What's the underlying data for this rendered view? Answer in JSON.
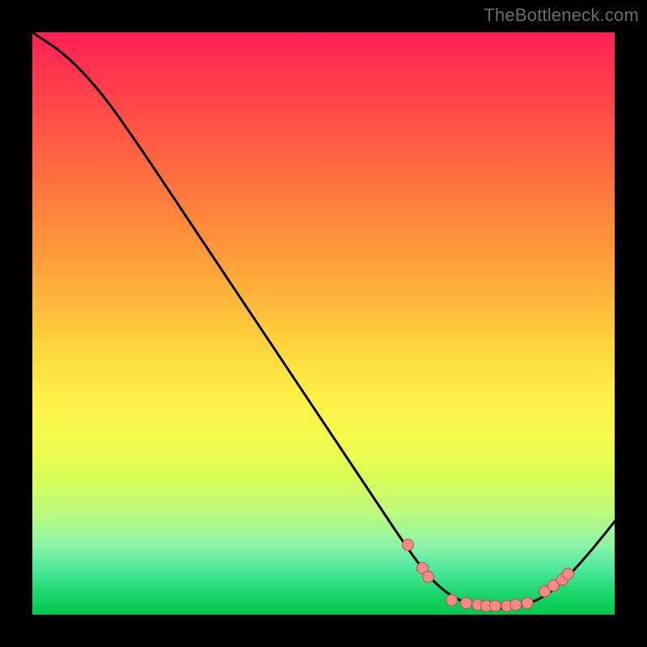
{
  "watermark": "TheBottleneck.com",
  "colors": {
    "line": "#000000",
    "dot_fill": "#f58b87",
    "dot_stroke": "#b84f4b"
  },
  "chart_data": {
    "type": "line",
    "title": "",
    "xlabel": "",
    "ylabel": "",
    "xlim": [
      0,
      100
    ],
    "ylim": [
      0,
      100
    ],
    "series": [
      {
        "name": "curve",
        "x": [
          0,
          6,
          12,
          18,
          24,
          30,
          36,
          42,
          48,
          54,
          60,
          64,
          68,
          72,
          76,
          80,
          84,
          88,
          92,
          96,
          100
        ],
        "y": [
          100,
          96,
          89.5,
          81,
          72,
          63,
          54,
          45,
          36,
          27,
          18,
          12,
          6.5,
          3,
          1.5,
          1,
          1.5,
          3,
          6.5,
          11,
          16
        ]
      }
    ],
    "markers": [
      {
        "x": 64.5,
        "y": 12.0
      },
      {
        "x": 67.0,
        "y": 8.0
      },
      {
        "x": 68.0,
        "y": 6.5
      },
      {
        "x": 72.0,
        "y": 2.5
      },
      {
        "x": 74.5,
        "y": 2.0
      },
      {
        "x": 76.5,
        "y": 1.7
      },
      {
        "x": 78.0,
        "y": 1.5
      },
      {
        "x": 79.5,
        "y": 1.5
      },
      {
        "x": 81.5,
        "y": 1.5
      },
      {
        "x": 83.0,
        "y": 1.7
      },
      {
        "x": 85.0,
        "y": 2.0
      },
      {
        "x": 88.0,
        "y": 4.0
      },
      {
        "x": 89.5,
        "y": 5.0
      },
      {
        "x": 91.0,
        "y": 6.0
      },
      {
        "x": 92.0,
        "y": 7.0
      }
    ]
  }
}
